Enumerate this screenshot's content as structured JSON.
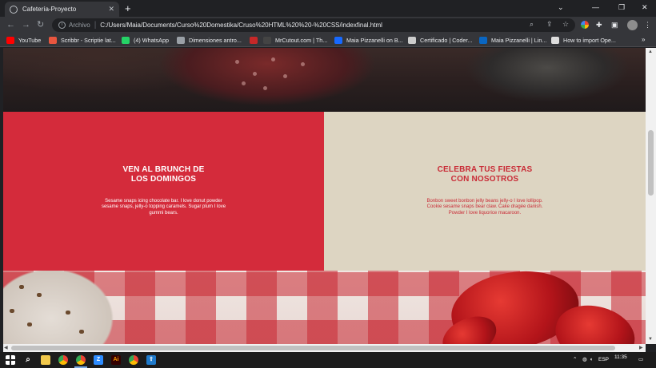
{
  "browser": {
    "tab_title": "Cafetería-Proyecto",
    "tab_close": "✕",
    "new_tab": "+",
    "window_controls": [
      "⌄",
      "—",
      "❐",
      "✕"
    ],
    "scheme_label": "Archivo",
    "url": "C:/Users/Maia/Documents/Curso%20Domestika/Cruso%20HTML%20%20-%20CSS/indexfinal.html"
  },
  "bookmarks": [
    {
      "label": "YouTube",
      "color": "#ff0000",
      "icon": "youtube-icon"
    },
    {
      "label": "Scribbr - Scriptie lat...",
      "color": "#e8563f",
      "icon": "scribbr-icon"
    },
    {
      "label": "(4) WhatsApp",
      "color": "#25d366",
      "icon": "whatsapp-icon"
    },
    {
      "label": "Dimensiones antro...",
      "color": "#9aa0a6",
      "icon": "globe-icon"
    },
    {
      "label": "",
      "color": "#c62828",
      "icon": "c-icon"
    },
    {
      "label": "MrCutout.com | Th...",
      "color": "#444444",
      "icon": "mrcutout-icon"
    },
    {
      "label": "Maia Pizzanelli on B...",
      "color": "#1769ff",
      "icon": "behance-icon"
    },
    {
      "label": "Certificado | Coder...",
      "color": "#cccccc",
      "icon": "coder-icon"
    },
    {
      "label": "Maia Pizzanelli | Lin...",
      "color": "#0a66c2",
      "icon": "linkedin-icon"
    },
    {
      "label": "How to import Ope...",
      "color": "#dddddd",
      "icon": "cloud-icon"
    }
  ],
  "bookmarks_more": "»",
  "page": {
    "left_panel": {
      "heading": "VEN AL BRUNCH DE\nLOS DOMINGOS",
      "body": "Sesame snaps icing chocolate bar. I love donut powder sesame snaps, jelly-o topping caramels. Sugar plum I love gummi bears.",
      "bg": "#d42b3b"
    },
    "right_panel": {
      "heading": "CELEBRA TUS FIESTAS\nCON NOSOTROS",
      "body": "Bonbon sweet bonbon jelly beans jelly-o I love lollipop. Cookie sesame snaps bear claw. Cake dragée danish. Powder I love liquorice macaroon.",
      "bg": "#ddd5c2"
    }
  },
  "taskbar": {
    "language": "ESP",
    "time": "11:35"
  }
}
